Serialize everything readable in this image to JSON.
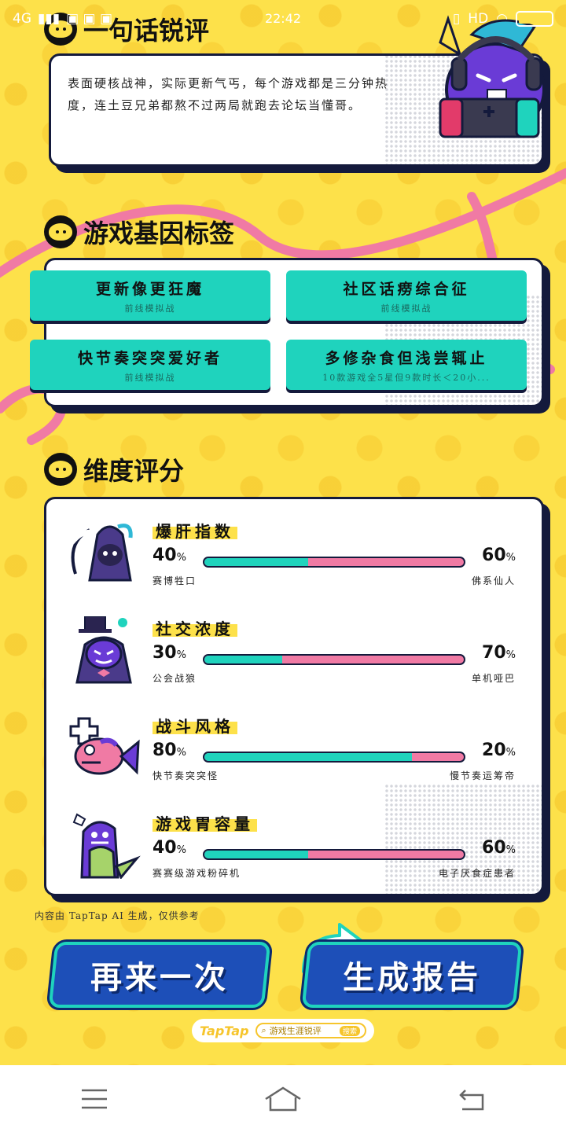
{
  "status_bar": {
    "network": "4G",
    "time": "22:42",
    "hd": "HD"
  },
  "sections": {
    "review_title": "一句话锐评",
    "tags_title": "游戏基因标签",
    "dimensions_title": "维度评分"
  },
  "review": {
    "text": "表面硬核战神，实际更新气丐，每个游戏都是三分钟热度，连土豆兄弟都熬不过两局就跑去论坛当懂哥。"
  },
  "tags": [
    {
      "title": "更新像更狂魔",
      "sub": "前线模拟战"
    },
    {
      "title": "社区话痨综合征",
      "sub": "前线模拟战"
    },
    {
      "title": "快节奏突突爱好者",
      "sub": "前线模拟战"
    },
    {
      "title": "多修杂食但浅尝辄止",
      "sub": "10款游戏全5星但9款时长＜20小..."
    }
  ],
  "dimensions": [
    {
      "name": "爆肝指数",
      "left_value": 40,
      "right_value": 60,
      "left_pct": "40",
      "right_pct": "60",
      "left_label": "赛博牲口",
      "right_label": "佛系仙人",
      "avatar": "reaper-mascot-icon"
    },
    {
      "name": "社交浓度",
      "left_value": 30,
      "right_value": 70,
      "left_pct": "30",
      "right_pct": "70",
      "left_label": "公会战狼",
      "right_label": "单机哑巴",
      "avatar": "magician-mascot-icon"
    },
    {
      "name": "战斗风格",
      "left_value": 80,
      "right_value": 20,
      "left_pct": "80",
      "right_pct": "20",
      "left_label": "快节奏突突怪",
      "right_label": "慢节奏运筹帝",
      "avatar": "fish-mascot-icon"
    },
    {
      "name": "游戏胃容量",
      "left_value": 40,
      "right_value": 60,
      "left_pct": "40",
      "right_pct": "60",
      "left_label": "赛赛级游戏粉碎机",
      "right_label": "电子厌食症患者",
      "avatar": "dinosaur-mascot-icon"
    }
  ],
  "percent_sign": "%",
  "disclaimer": "内容由 TapTap AI 生成，仅供参考",
  "buttons": {
    "retry": "再来一次",
    "report": "生成报告"
  },
  "brand": {
    "logo": "TapTap",
    "search": "游戏生涯锐评",
    "badge": "搜索"
  },
  "colors": {
    "background": "#fde14a",
    "teal": "#1fd3bd",
    "pink": "#f07aa4",
    "navy": "#141a3c",
    "button_blue": "#1d4fb8"
  }
}
